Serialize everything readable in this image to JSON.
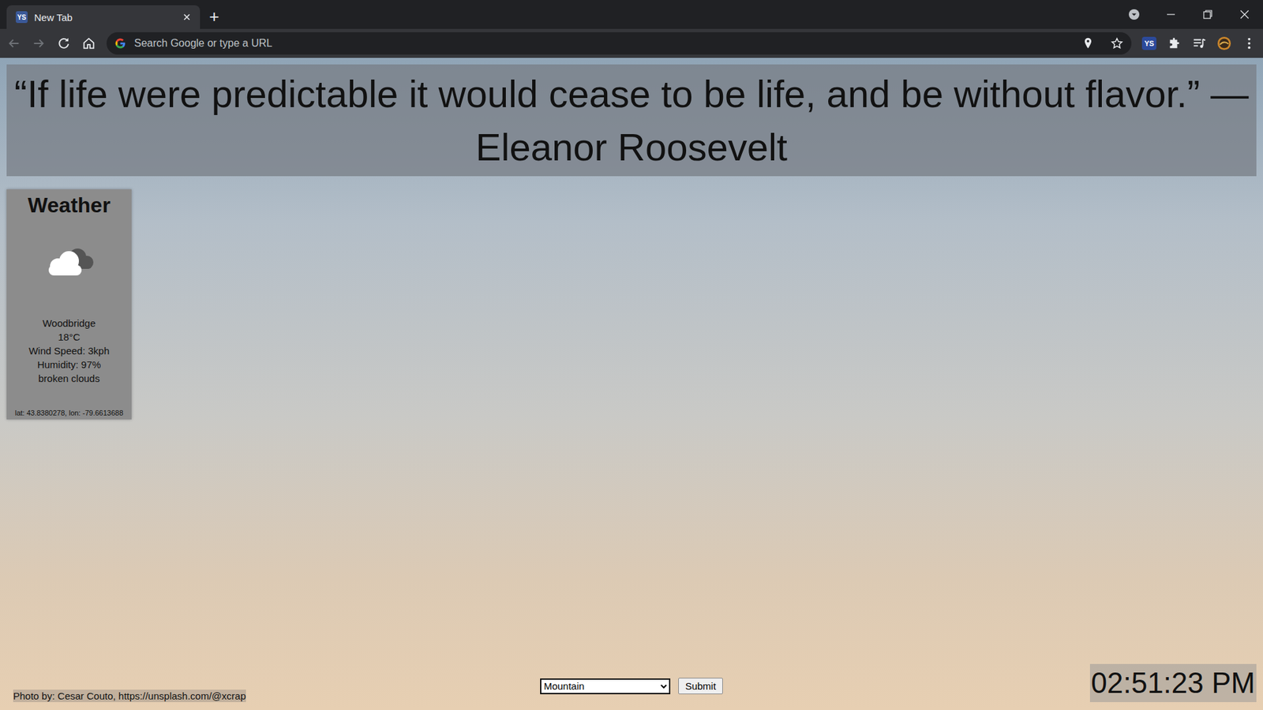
{
  "browser": {
    "tabs": [
      {
        "label": "New Tab",
        "selected": true,
        "favicon": "YS"
      }
    ],
    "new_tab_button": "+",
    "address_bar": {
      "placeholder": "Search Google or type a URL"
    },
    "extension_badge": "YS"
  },
  "quote": {
    "text": "“If life were predictable it would cease to be life, and be without flavor.” — Eleanor Roosevelt"
  },
  "weather": {
    "title": "Weather",
    "city": "Woodbridge",
    "temperature": "18°C",
    "wind": "Wind Speed: 3kph",
    "humidity": "Humidity: 97%",
    "description": "broken clouds",
    "coords": "lat: 43.8380278, lon: -79.6613688"
  },
  "photo_credit": "Photo by: Cesar Couto, https://unsplash.com/@xcrap",
  "theme_picker": {
    "value": "Mountain",
    "button": "Submit"
  },
  "clock": "02:51:23 PM"
}
